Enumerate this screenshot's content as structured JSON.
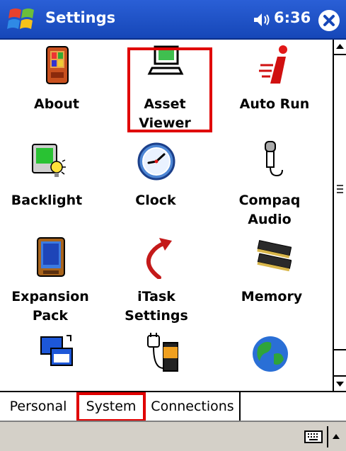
{
  "window": {
    "title": "Settings",
    "time": "6:36"
  },
  "items": [
    {
      "label": "About"
    },
    {
      "label": "Asset\nViewer"
    },
    {
      "label": "Auto Run"
    },
    {
      "label": "Backlight"
    },
    {
      "label": "Clock"
    },
    {
      "label": "Compaq\nAudio"
    },
    {
      "label": "Expansion\nPack"
    },
    {
      "label": "iTask\nSettings"
    },
    {
      "label": "Memory"
    }
  ],
  "tabs": [
    {
      "label": "Personal"
    },
    {
      "label": "System"
    },
    {
      "label": "Connections"
    }
  ],
  "colors": {
    "titlebar": "#1f56c8",
    "highlight": "#e00000",
    "menubar": "#d4d0c8"
  }
}
